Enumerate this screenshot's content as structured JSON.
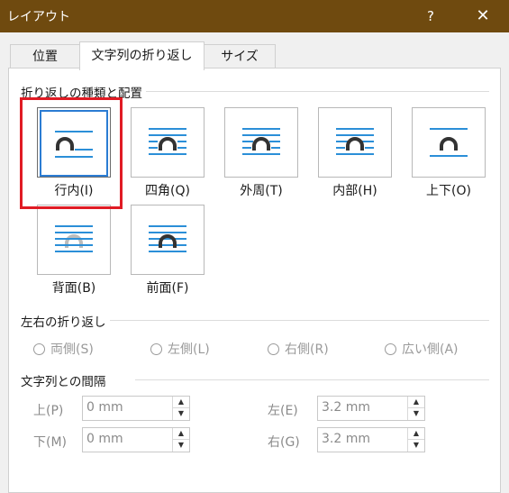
{
  "window": {
    "title": "レイアウト",
    "help_glyph": "?",
    "close_glyph": "✕"
  },
  "tabs": [
    {
      "label": "位置",
      "active": false
    },
    {
      "label": "文字列の折り返し",
      "active": true
    },
    {
      "label": "サイズ",
      "active": false
    }
  ],
  "wrap_section": {
    "label": "折り返しの種類と配置",
    "options": [
      {
        "label": "行内(I)",
        "icon": "inline-with-text-icon",
        "selected": true
      },
      {
        "label": "四角(Q)",
        "icon": "square-wrap-icon",
        "selected": false
      },
      {
        "label": "外周(T)",
        "icon": "tight-wrap-icon",
        "selected": false
      },
      {
        "label": "内部(H)",
        "icon": "through-wrap-icon",
        "selected": false
      },
      {
        "label": "上下(O)",
        "icon": "top-bottom-wrap-icon",
        "selected": false
      },
      {
        "label": "背面(B)",
        "icon": "behind-text-icon",
        "selected": false
      },
      {
        "label": "前面(F)",
        "icon": "in-front-of-text-icon",
        "selected": false
      }
    ]
  },
  "wrap_text_section": {
    "label": "左右の折り返し",
    "options": [
      {
        "label": "両側(S)"
      },
      {
        "label": "左側(L)"
      },
      {
        "label": "右側(R)"
      },
      {
        "label": "広い側(A)"
      }
    ]
  },
  "distance_section": {
    "label": "文字列との間隔",
    "fields": {
      "top": {
        "label": "上(P)",
        "value": "0 mm"
      },
      "bottom": {
        "label": "下(M)",
        "value": "0 mm"
      },
      "left": {
        "label": "左(E)",
        "value": "3.2 mm"
      },
      "right": {
        "label": "右(G)",
        "value": "3.2 mm"
      }
    }
  },
  "colors": {
    "titlebar": "#6f4a0f",
    "accent": "#2b7cd3",
    "highlight": "#e01b24",
    "icon_lines": "#2b8fd8"
  }
}
